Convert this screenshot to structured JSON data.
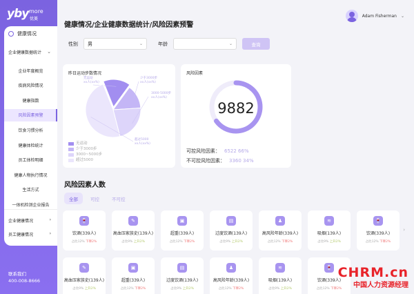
{
  "brand": {
    "mark": "yby",
    "line1": "more",
    "line2": "优美"
  },
  "nav": {
    "home": "健康情况",
    "group": "企业健康数据统计",
    "items": [
      "企业年度概览",
      "疾病风险情况",
      "健康指数",
      "风险因素预警",
      "饮食习惯分析",
      "健康体检统计",
      "员工体检明细",
      "健康人物执行情况",
      "生活方式",
      "一体机检测企业报告"
    ],
    "active_index": 3,
    "collapsed": [
      "企业健康情况",
      "员工健康情况"
    ]
  },
  "contact": {
    "label": "联系我们",
    "phone": "400-008-8666"
  },
  "header": {
    "breadcrumb": "健康情况/企业健康数据统计/风险因素预警",
    "user_name": "Adam Fisherman"
  },
  "filter": {
    "gender_label": "性别",
    "gender_value": "男",
    "age_label": "年龄",
    "age_value": "",
    "query_label": "查询"
  },
  "steps_card": {
    "title": "昨日运动步数情况",
    "slices": [
      {
        "label": "无运动",
        "sub": "xx人(xx%)",
        "share": 0.16,
        "color": "#a28ef0"
      },
      {
        "label": "少于3000步",
        "sub": "xx人(xx%)",
        "share": 0.14,
        "color": "#c4b6f6"
      },
      {
        "label": "3000-5000步",
        "sub": "xx人(xx%)",
        "share": 0.22,
        "color": "#ddd5fa"
      },
      {
        "label": "超过5000",
        "sub": "xx人(xx%)",
        "share": 0.48,
        "color": "#ebe6fc"
      }
    ],
    "legend": [
      "无运动",
      "少于3000步",
      "3000~5000步",
      "超过5000"
    ]
  },
  "risk_card": {
    "title": "风险因素",
    "total": "9882",
    "progress": 0.65,
    "controllable_label": "可控风险因素：",
    "controllable_value": "6522 66%",
    "uncontrollable_label": "不可控风险因素：",
    "uncontrollable_value": "3360 34%"
  },
  "section": {
    "title": "风险因素人数",
    "tabs": [
      "全部",
      "可控",
      "不可控"
    ],
    "active_tab": 0
  },
  "risk_rows": [
    [
      {
        "name": "饮酒(339人)",
        "stat_prefix": "占比12%",
        "trend": "下降2%",
        "dir": "dn",
        "icon": "🍷"
      },
      {
        "name": "高血压家族史(139人)",
        "stat_prefix": "占比9%",
        "trend": "上升2%",
        "dir": "up",
        "icon": "✎"
      },
      {
        "name": "超重(339人)",
        "stat_prefix": "占比12%",
        "trend": "下降2%",
        "dir": "dn",
        "icon": "▣"
      },
      {
        "name": "过度饮酒(139人)",
        "stat_prefix": "占比9%",
        "trend": "上升2%",
        "dir": "up",
        "icon": "▤"
      },
      {
        "name": "高风险年龄(339人)",
        "stat_prefix": "占比12%",
        "trend": "下降2%",
        "dir": "dn",
        "icon": "♟"
      },
      {
        "name": "吸烟(139人)",
        "stat_prefix": "占比9%",
        "trend": "上升2%",
        "dir": "up",
        "icon": "≋"
      },
      {
        "name": "饮酒(339人)",
        "stat_prefix": "占比12%",
        "trend": "下降2%",
        "dir": "dn",
        "icon": "🍷"
      }
    ],
    [
      {
        "name": "高血压家族史(139人)",
        "stat_prefix": "占比9%",
        "trend": "上升2%",
        "dir": "up",
        "icon": "✎"
      },
      {
        "name": "超重(339人)",
        "stat_prefix": "占比12%",
        "trend": "下降2%",
        "dir": "dn",
        "icon": "▣"
      },
      {
        "name": "过度饮酒(139人)",
        "stat_prefix": "占比9%",
        "trend": "上升2%",
        "dir": "up",
        "icon": "▤"
      },
      {
        "name": "高风险年龄(339人)",
        "stat_prefix": "占比12%",
        "trend": "下降2%",
        "dir": "dn",
        "icon": "♟"
      },
      {
        "name": "吸烟(139人)",
        "stat_prefix": "占比9%",
        "trend": "上升2%",
        "dir": "up",
        "icon": "≋"
      },
      {
        "name": "饮酒(339人)",
        "stat_prefix": "占比12%",
        "trend": "下降2%",
        "dir": "dn",
        "icon": "🍷"
      }
    ]
  ],
  "watermark": {
    "main": "CHRM.cn",
    "sub": "中国人力资源经理"
  }
}
